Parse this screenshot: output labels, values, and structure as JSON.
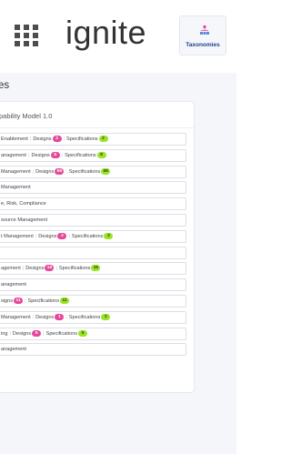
{
  "header": {
    "brand": "ignite",
    "taxonomies_label": "Taxonomies"
  },
  "colors": {
    "designs_badge": "#e8489a",
    "specifications_badge": "#9be22b",
    "taxonomies_icon": "#e8489a"
  },
  "page": {
    "title": "es",
    "card_title": "pability Model 1.0"
  },
  "capabilities": [
    {
      "name": "Enablement",
      "designs": "2",
      "designs_label": "Designs",
      "specs": "2",
      "specs_label": "Specifications"
    },
    {
      "name": "anagement",
      "designs": "8",
      "designs_label": "Designs",
      "specs": "8",
      "specs_label": "Specifications"
    },
    {
      "name": "Management",
      "designs": "68",
      "designs_label": "Designs",
      "specs": "68",
      "specs_label": "Specifications"
    },
    {
      "name": "Management"
    },
    {
      "name": "e, Risk, Compliance"
    },
    {
      "name": "source Management"
    },
    {
      "name": "t Management",
      "designs": "2",
      "designs_label": "Designs",
      "specs": "3",
      "specs_label": "Specifications"
    },
    {
      "name": ""
    },
    {
      "name": "agement",
      "designs": "16",
      "designs_label": "Designs",
      "specs": "16",
      "specs_label": "Specifications"
    },
    {
      "name": "anagement"
    },
    {
      "name": "signs",
      "designs": "11",
      "specs": "11",
      "specs_label": "Specifications"
    },
    {
      "name": "Management",
      "designs": "1",
      "designs_label": "Designs",
      "specs": "2",
      "specs_label": "Specifications"
    },
    {
      "name": "ing",
      "designs": "5",
      "designs_label": "Designs",
      "specs": "5",
      "specs_label": "Specifications"
    },
    {
      "name": "anagement"
    }
  ]
}
